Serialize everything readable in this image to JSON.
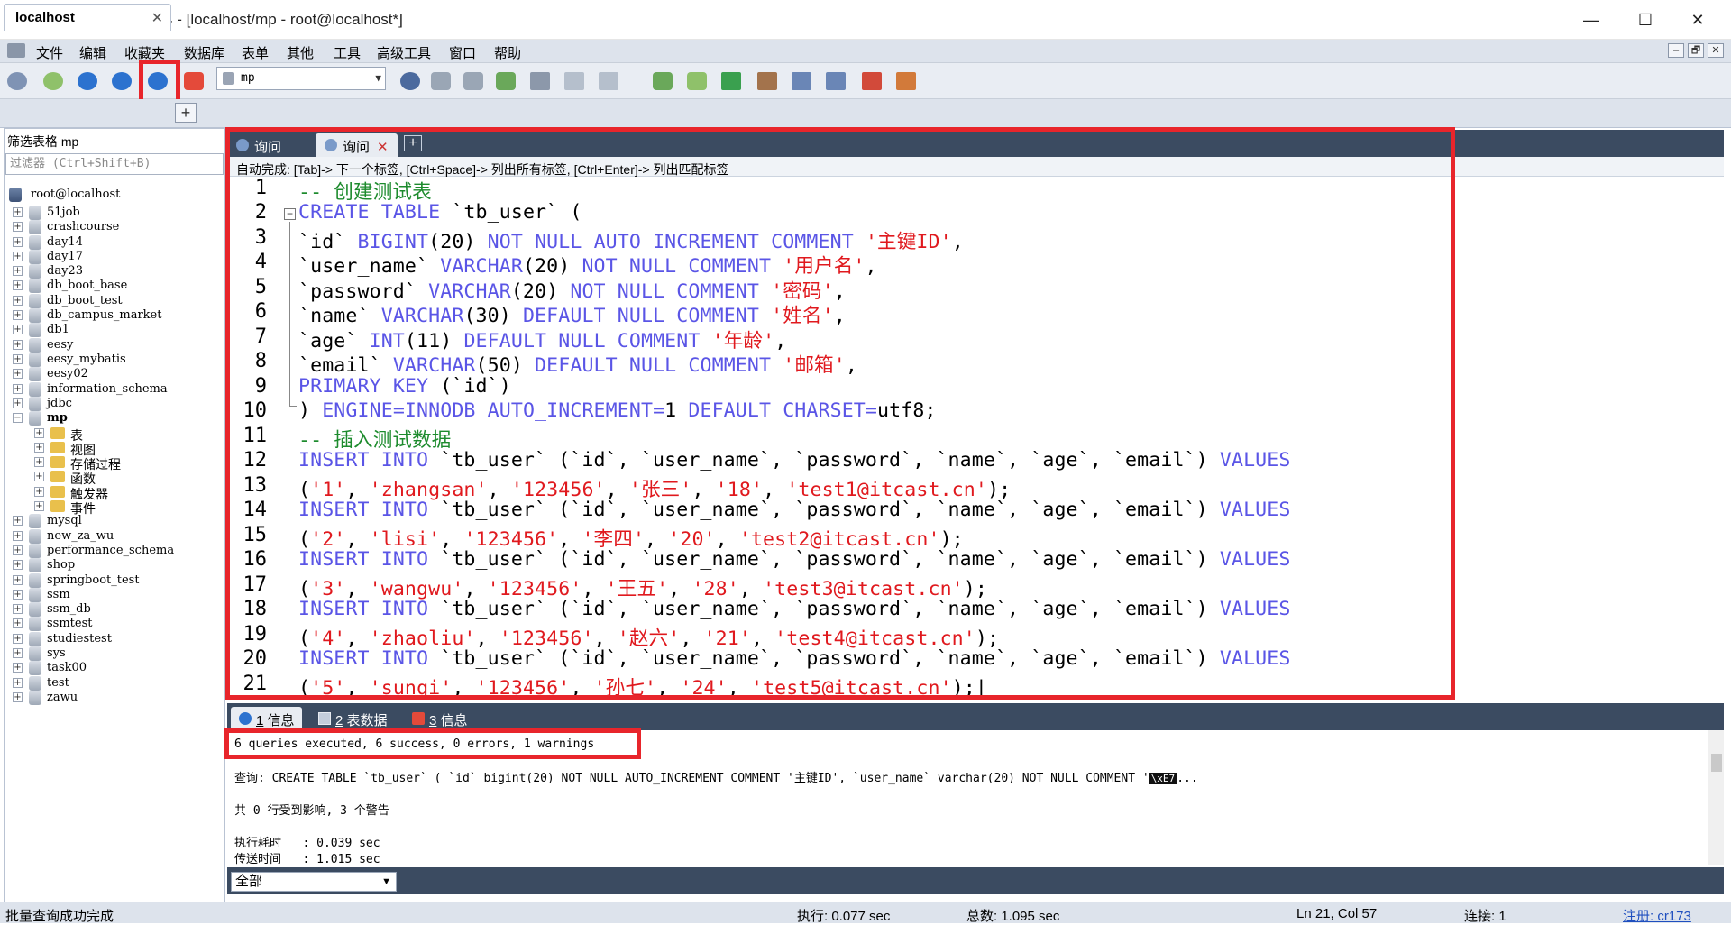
{
  "window": {
    "title": "SQLyog Ultimate 64 - [localhost/mp - root@localhost*]",
    "minimize": "—",
    "maximize": "☐",
    "close": "✕"
  },
  "menu": [
    "文件",
    "编辑",
    "收藏夹",
    "数据库",
    "表单",
    "其他",
    "工具",
    "高级工具",
    "窗口",
    "帮助"
  ],
  "mdi_buttons": [
    "–",
    "🗗",
    "✕"
  ],
  "toolbar": {
    "database_select": "mp",
    "icons": [
      "new-connection-icon",
      "connect-icon",
      "execute-query-icon",
      "execute-all-icon",
      "execute-current-icon",
      "stop-icon",
      "database-icon",
      "user-icon",
      "backup-icon",
      "restore-icon",
      "sync-icon",
      "schema-icon",
      "table-icon",
      "copy-icon",
      "import-icon",
      "export-icon",
      "query-builder-icon",
      "schema-designer-icon",
      "scheduled-job-icon",
      "report-icon",
      "grid-icon"
    ]
  },
  "connection_tab": {
    "label": "localhost",
    "close": "✕",
    "add": "+"
  },
  "left_pane": {
    "filter_label": "筛选表格 mp",
    "filter_placeholder": "过滤器 (Ctrl+Shift+B)",
    "root": "root@localhost",
    "databases_before": [
      "51job",
      "crashcourse",
      "day14",
      "day17",
      "day23",
      "db_boot_base",
      "db_boot_test",
      "db_campus_market",
      "db1",
      "eesy",
      "eesy_mybatis",
      "eesy02",
      "information_schema",
      "jdbc"
    ],
    "expanded_db": "mp",
    "mp_children": [
      "表",
      "视图",
      "存储过程",
      "函数",
      "触发器",
      "事件"
    ],
    "databases_after": [
      "mysql",
      "new_za_wu",
      "performance_schema",
      "shop",
      "springboot_test",
      "ssm",
      "ssm_db",
      "ssmtest",
      "studiestest",
      "sys",
      "task00",
      "test",
      "zawu"
    ]
  },
  "query_tabs": [
    {
      "label": "询问",
      "active": false
    },
    {
      "label": "询问",
      "active": true,
      "close": "✕"
    }
  ],
  "query_add": "+",
  "autocomplete_hint": "自动完成: [Tab]-> 下一个标签, [Ctrl+Space]-> 列出所有标签, [Ctrl+Enter]-> 列出匹配标签",
  "editor": {
    "line_numbers": [
      "1",
      "2",
      "3",
      "4",
      "5",
      "6",
      "7",
      "8",
      "9",
      "10",
      "11",
      "12",
      "13",
      "14",
      "15",
      "16",
      "17",
      "18",
      "19",
      "20",
      "21"
    ]
  },
  "result_tabs": [
    {
      "num": "1",
      "label": "信息",
      "active": true
    },
    {
      "num": "2",
      "label": "表数据",
      "active": false
    },
    {
      "num": "3",
      "label": "信息",
      "active": false
    }
  ],
  "result": {
    "summary": "6 queries executed, 6 success, 0 errors, 1 warnings",
    "query_line": "查询: CREATE TABLE `tb_user` ( `id` bigint(20) NOT NULL AUTO_INCREMENT COMMENT '主键ID', `user_name` varchar(20) NOT NULL COMMENT '",
    "query_badge": "\\xE7",
    "query_ellipsis": "...",
    "affected": "共 0 行受到影响, 3 个警告",
    "exec_time": "执行耗时   : 0.039 sec",
    "transfer_time": "传送时间   : 1.015 sec"
  },
  "filter_select": "全部",
  "status": {
    "left": "批量查询成功完成",
    "exec": "执行: 0.077 sec",
    "total": "总数: 1.095 sec",
    "position": "Ln 21, Col 57",
    "connections": "连接: 1",
    "register": "注册: cr173"
  },
  "colors": {
    "keyword": "#5a55e6",
    "string": "#e0191e",
    "comment": "#1d8b2d",
    "highlight_box": "#e8252b",
    "dark_tab_bar": "#3b4b61"
  }
}
